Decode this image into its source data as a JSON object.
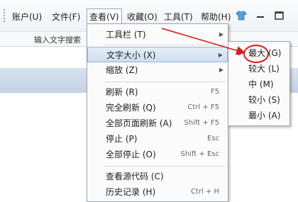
{
  "menubar": {
    "items": [
      {
        "label": "账户(U)"
      },
      {
        "label": "文件(F)"
      },
      {
        "label": "查看(V)"
      },
      {
        "label": "收藏(O)"
      },
      {
        "label": "工具(T)"
      },
      {
        "label": "帮助(H)"
      }
    ],
    "icons": [
      "tshirt-icon",
      "minimize-icon",
      "maximize-icon"
    ]
  },
  "toolbar": {
    "search_label": "输入文字搜索"
  },
  "view_menu": {
    "items": [
      {
        "label": "工具栏 (T)",
        "has_submenu": true
      },
      {
        "label": "文字大小 (X)",
        "has_submenu": true
      },
      {
        "label": "缩放 (Z)",
        "has_submenu": true
      },
      {
        "label": "刷新 (R)",
        "shortcut": "F5"
      },
      {
        "label": "完全刷新 (Q)",
        "shortcut": "Ctrl + F5"
      },
      {
        "label": "全部页面刷新 (A)",
        "shortcut": "Shift + F5"
      },
      {
        "label": "停止 (P)",
        "shortcut": "Esc"
      },
      {
        "label": "全部停止 (O)",
        "shortcut": "Shift + Esc"
      },
      {
        "label": "查看源代码 (C)"
      },
      {
        "label": "历史记录 (H)",
        "shortcut": "Ctrl + H"
      }
    ]
  },
  "text_size_menu": {
    "items": [
      {
        "label": "最大 (G)",
        "selected": true
      },
      {
        "label": "较大 (L)"
      },
      {
        "label": "中 (M)"
      },
      {
        "label": "较小 (S)"
      },
      {
        "label": "最小 (A)"
      }
    ]
  },
  "colors": {
    "highlight": "#cfdeee",
    "annotation": "#e01818"
  }
}
